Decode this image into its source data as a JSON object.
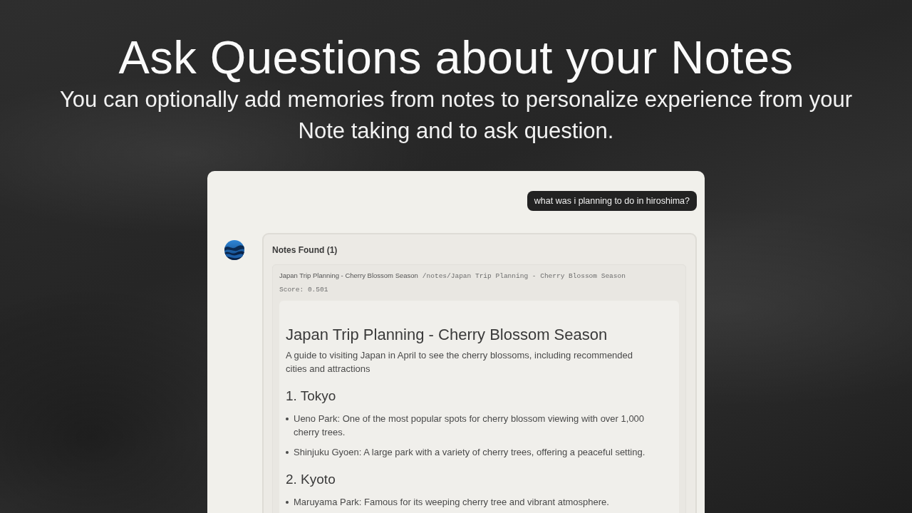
{
  "hero": {
    "title": "Ask Questions about your Notes",
    "subtitle": "You can optionally add memories from notes to personalize experience from your Note taking and to ask question."
  },
  "chat": {
    "user_message": "what was i planning to do in hiroshima?",
    "response": {
      "header": "Notes Found (1)",
      "results": [
        {
          "title": "Japan Trip Planning - Cherry Blossom Season",
          "path": "/notes/Japan Trip Planning - Cherry Blossom Season",
          "score": "Score: 0.501",
          "note": {
            "title": "Japan Trip Planning - Cherry Blossom Season",
            "description": "A guide to visiting Japan in April to see the cherry blossoms, including recommended cities and attractions",
            "sections": [
              {
                "heading": "1. Tokyo",
                "items": [
                  "Ueno Park: One of the most popular spots for cherry blossom viewing with over 1,000 cherry trees.",
                  "Shinjuku Gyoen: A large park with a variety of cherry trees, offering a peaceful setting."
                ]
              },
              {
                "heading": "2. Kyoto",
                "items": [
                  "Maruyama Park: Famous for its weeping cherry tree and vibrant atmosphere."
                ]
              }
            ]
          }
        }
      ]
    }
  }
}
